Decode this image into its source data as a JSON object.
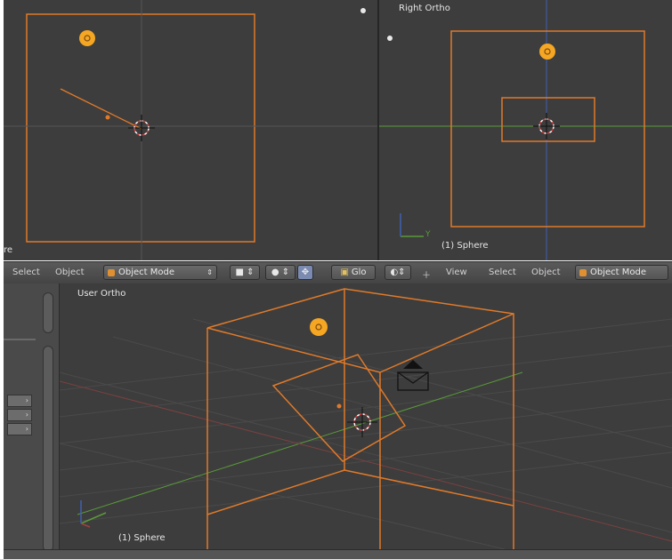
{
  "top_left_viewport": {
    "side_label": "re"
  },
  "top_right_viewport": {
    "title": "Right Ortho",
    "object_label": "(1) Sphere",
    "axis_y": "Y"
  },
  "header_left": {
    "select_label": "Select",
    "object_label": "Object",
    "mode_label": "Object Mode",
    "global_label": "Glo"
  },
  "header_right": {
    "view_label": "View",
    "select_label": "Select",
    "object_label": "Object",
    "mode_label": "Object Mode"
  },
  "bottom_viewport": {
    "title": "User Ortho",
    "object_label": "(1) Sphere"
  },
  "colors": {
    "viewport_bg": "#3d3d3d",
    "selection": "#e07a2a",
    "lamp": "#f5a623",
    "grid": "#4a4a4a",
    "x_axis": "#a04040",
    "y_axis": "#5a9a3a",
    "z_axis": "#4060b0"
  },
  "icons": [
    "lamp-icon",
    "cursor-3d-icon",
    "camera-icon",
    "axis-gizmo-icon",
    "object-mode-icon"
  ]
}
